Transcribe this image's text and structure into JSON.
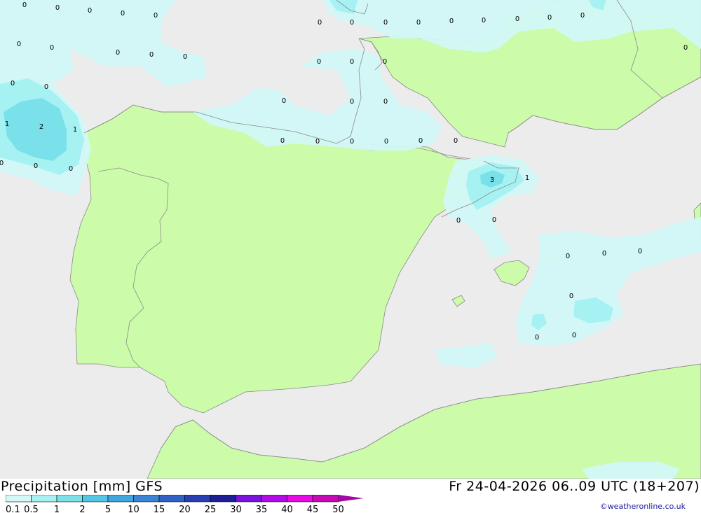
{
  "map": {
    "colors": {
      "sea": "#ececec",
      "land": "#ccfcaa",
      "precip_light": "#d2f8f8",
      "precip_mid": "#a6f2f2",
      "precip_high": "#7ae0ea",
      "coast": "#8a8a8a"
    },
    "contour_labels": [
      {
        "id": "c1",
        "text": "0"
      },
      {
        "id": "c2",
        "text": "0"
      },
      {
        "id": "c3",
        "text": "0"
      },
      {
        "id": "c4",
        "text": "0"
      },
      {
        "id": "c5",
        "text": "0"
      },
      {
        "id": "c6",
        "text": "0"
      },
      {
        "id": "c7",
        "text": "0"
      },
      {
        "id": "c8",
        "text": "0"
      },
      {
        "id": "c9",
        "text": "0"
      },
      {
        "id": "c10",
        "text": "0"
      },
      {
        "id": "c11",
        "text": "0"
      },
      {
        "id": "c12",
        "text": "0"
      },
      {
        "id": "c13",
        "text": "0"
      },
      {
        "id": "c14",
        "text": "0"
      },
      {
        "id": "c15",
        "text": "0"
      },
      {
        "id": "c16",
        "text": "0"
      },
      {
        "id": "c17",
        "text": "0"
      },
      {
        "id": "c18",
        "text": "0"
      },
      {
        "id": "c19",
        "text": "0"
      },
      {
        "id": "c20",
        "text": "0"
      },
      {
        "id": "c21",
        "text": "0"
      },
      {
        "id": "c22",
        "text": "0"
      },
      {
        "id": "c23",
        "text": "0"
      },
      {
        "id": "c24",
        "text": "0"
      },
      {
        "id": "c25",
        "text": "0"
      },
      {
        "id": "c26",
        "text": "0"
      },
      {
        "id": "c27",
        "text": "1"
      },
      {
        "id": "c28",
        "text": "2"
      },
      {
        "id": "c29",
        "text": "1"
      },
      {
        "id": "c30",
        "text": "0"
      },
      {
        "id": "c31",
        "text": "0"
      },
      {
        "id": "c32",
        "text": "0"
      },
      {
        "id": "c33",
        "text": "0"
      },
      {
        "id": "c34",
        "text": "0"
      },
      {
        "id": "c35",
        "text": "0"
      },
      {
        "id": "c36",
        "text": "0"
      },
      {
        "id": "c37",
        "text": "0"
      },
      {
        "id": "c38",
        "text": "0"
      },
      {
        "id": "c39",
        "text": "3"
      },
      {
        "id": "c40",
        "text": "1"
      },
      {
        "id": "c41",
        "text": "0"
      },
      {
        "id": "c42",
        "text": "0"
      },
      {
        "id": "c43",
        "text": "0"
      },
      {
        "id": "c44",
        "text": "0"
      },
      {
        "id": "c45",
        "text": "0"
      },
      {
        "id": "c46",
        "text": "0"
      },
      {
        "id": "c47",
        "text": "0"
      },
      {
        "id": "c48",
        "text": "0"
      }
    ]
  },
  "footer": {
    "title": "Precipitation [mm] GFS",
    "valid_time": "Fr 24-04-2026 06..09 UTC (18+207)",
    "credit": "©weatheronline.co.uk"
  },
  "legend": {
    "values": [
      "0.1",
      "0.5",
      "1",
      "2",
      "5",
      "10",
      "15",
      "20",
      "25",
      "30",
      "35",
      "40",
      "45",
      "50"
    ],
    "colors": [
      "#d2f8f8",
      "#a6f2f2",
      "#7ae0ea",
      "#52c8e6",
      "#40a6e0",
      "#3a84d8",
      "#3262c8",
      "#2840b4",
      "#1e1e96",
      "#7a14dc",
      "#b40ae6",
      "#e60ae6",
      "#c80ab4",
      "#a00aa0"
    ]
  }
}
